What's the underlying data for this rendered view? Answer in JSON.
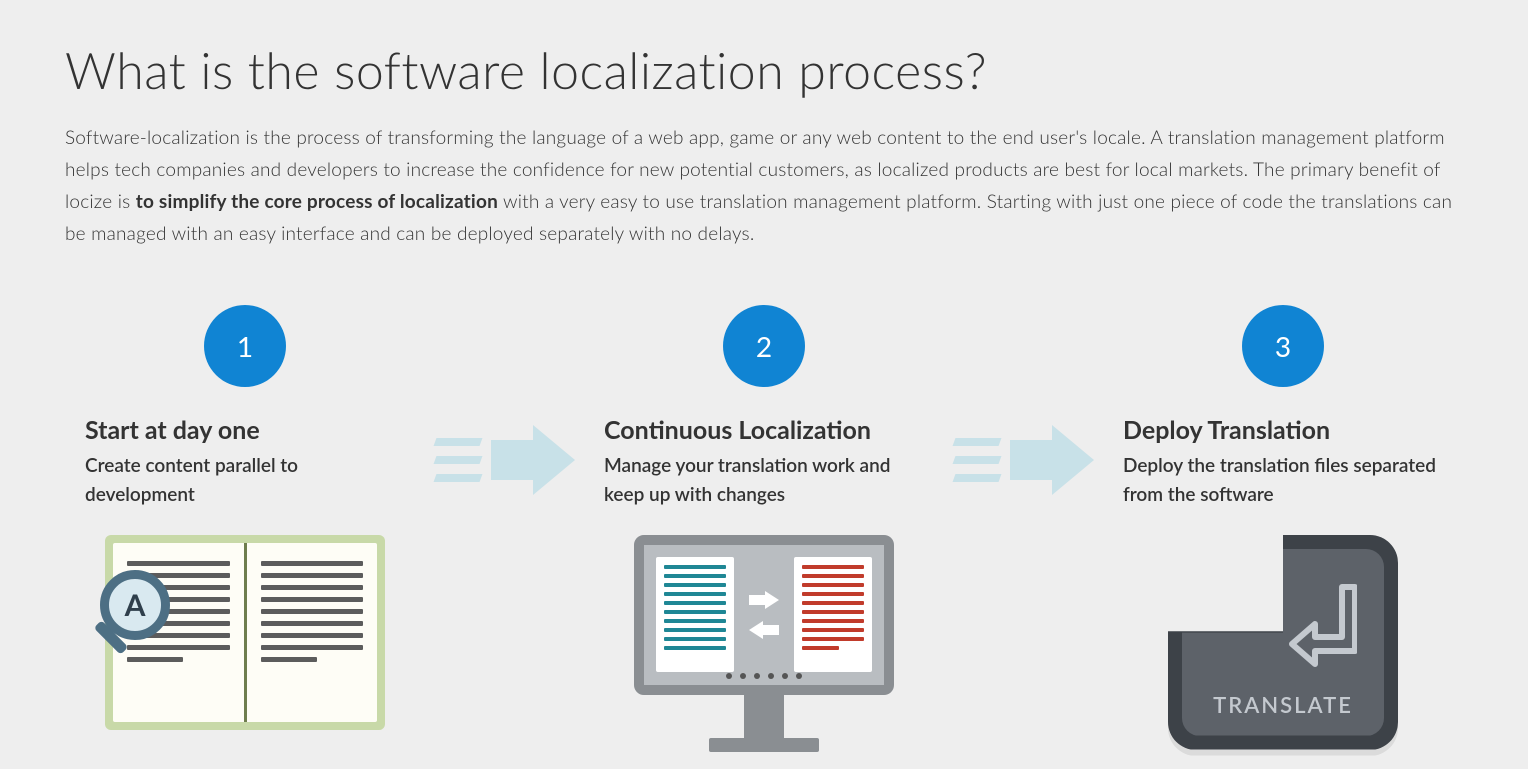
{
  "heading": "What is the software localization process?",
  "intro_before": "Software-localization is the process of transforming the language of a web app, game or any web content to the end user's locale. A translation management platform helps tech companies and developers to increase the confidence for new potential customers, as localized products are best for local markets. The primary benefit of locize is ",
  "intro_bold": "to simplify the core process of localization",
  "intro_after": " with a very easy to use translation management platform. Starting with just one piece of code the translations can be managed with an easy interface and can be deployed separately with no delays.",
  "steps": [
    {
      "num": "1",
      "title": "Start at day one",
      "sub": "Create content parallel to development"
    },
    {
      "num": "2",
      "title": "Continuous Localization",
      "sub": "Manage your translation work and keep up with changes"
    },
    {
      "num": "3",
      "title": "Deploy Translation",
      "sub": "Deploy the translation files separated from the software"
    }
  ],
  "icons": {
    "magnifier_letter": "A",
    "translate_key_label": "TRANSLATE"
  },
  "colors": {
    "accent_blue": "#1084d3",
    "arrow_light": "#c8e1e8"
  }
}
